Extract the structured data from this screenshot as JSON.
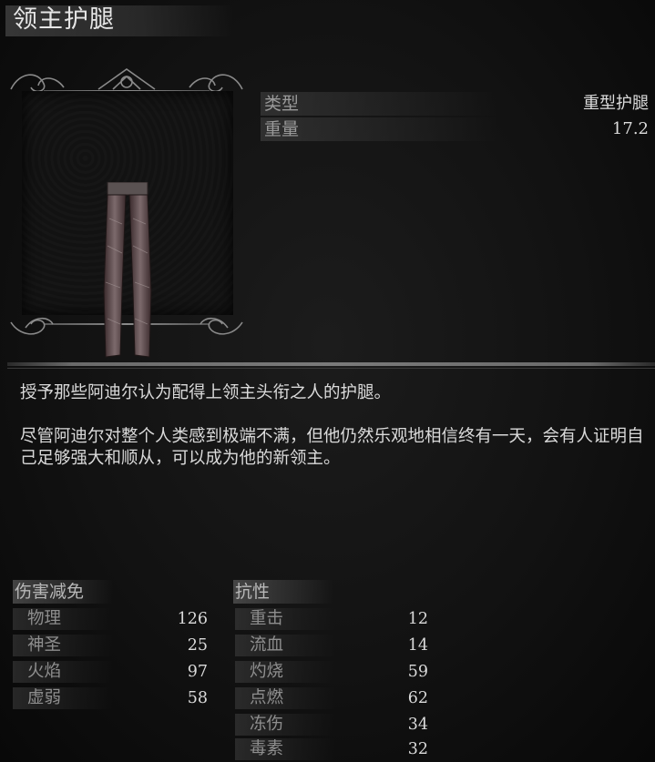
{
  "title": "领主护腿",
  "item": {
    "type_label": "类型",
    "type_value": "重型护腿",
    "weight_label": "重量",
    "weight_value": "17.2"
  },
  "description": [
    "授予那些阿迪尔认为配得上领主头衔之人的护腿。",
    "尽管阿迪尔对整个人类感到极端不满，但他仍然乐观地相信终有一天，会有人证明自己足够强大和顺从，可以成为他的新领主。"
  ],
  "damage_reduction": {
    "header": "伤害减免",
    "rows": [
      {
        "label": "物理",
        "value": "126"
      },
      {
        "label": "神圣",
        "value": "25"
      },
      {
        "label": "火焰",
        "value": "97"
      },
      {
        "label": "虚弱",
        "value": "58"
      }
    ]
  },
  "resistance": {
    "header": "抗性",
    "rows": [
      {
        "label": "重击",
        "value": "12"
      },
      {
        "label": "流血",
        "value": "14"
      },
      {
        "label": "灼烧",
        "value": "59"
      },
      {
        "label": "点燃",
        "value": "62"
      },
      {
        "label": "冻伤",
        "value": "34"
      },
      {
        "label": "毒素",
        "value": "32"
      }
    ]
  },
  "colors": {
    "background": "#0b0b0b",
    "text": "#dadada",
    "label": "#8e8e8e"
  },
  "icons": [
    "ornate-frame-icon",
    "greaves-item-icon"
  ]
}
